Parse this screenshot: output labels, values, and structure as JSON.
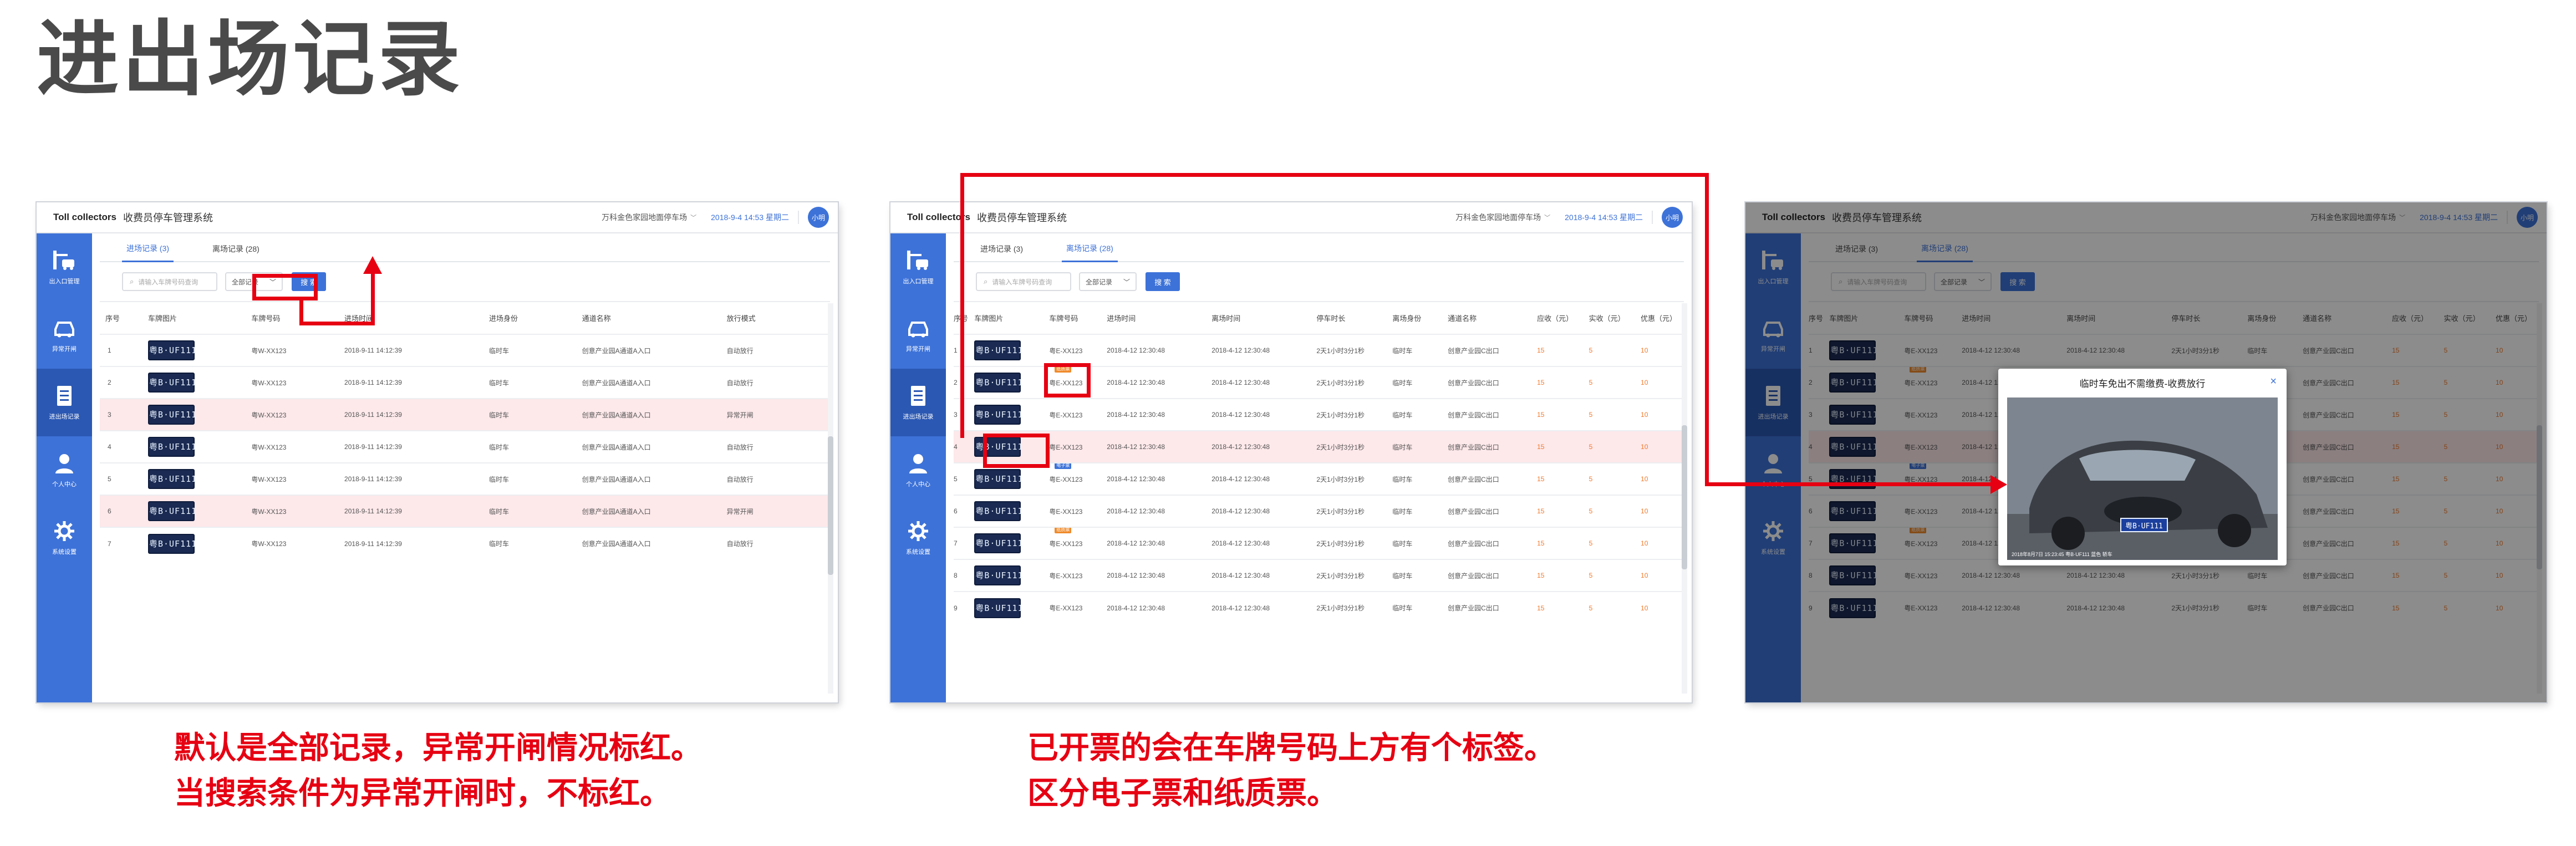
{
  "page": {
    "title": "进出场记录",
    "caption_left": [
      "默认是全部记录，异常开闸情况标红。",
      "当搜索条件为异常开闸时，不标红。"
    ],
    "caption_right": [
      "已开票的会在车牌号码上方有个标签。",
      "区分电子票和纸质票。"
    ]
  },
  "app": {
    "brand": "Toll collectors",
    "system": "收费员停车管理系统",
    "lot": "万科金色家园地面停车场",
    "datetime": "2018-9-4 14:53 星期二",
    "user": "小明",
    "sidebar": [
      {
        "label": "出入口管理",
        "icon": "gate-icon"
      },
      {
        "label": "异常开闸",
        "icon": "car-icon"
      },
      {
        "label": "进出场记录",
        "icon": "document-icon"
      },
      {
        "label": "个人中心",
        "icon": "user-icon"
      },
      {
        "label": "系统设置",
        "icon": "gear-icon"
      }
    ],
    "tabs": [
      "进场记录  (3)",
      "离场记录  (28)"
    ],
    "search_placeholder": "请输入车牌号码查询",
    "filter_value": "全部记录",
    "search_button": "搜 索"
  },
  "entry_table": {
    "headers": [
      "序号",
      "车牌图片",
      "车牌号码",
      "进场时间",
      "进场身份",
      "通道名称",
      "放行模式"
    ],
    "rows": [
      {
        "no": "1",
        "plate_img": "粤B·UF111",
        "plate": "粤W-XX123",
        "time": "2018-9-11 14:12:39",
        "identity": "临时车",
        "channel": "创意产业园A通道A入口",
        "mode": "自动放行",
        "abnormal": false
      },
      {
        "no": "2",
        "plate_img": "粤B·UF111",
        "plate": "粤W-XX123",
        "time": "2018-9-11 14:12:39",
        "identity": "临时车",
        "channel": "创意产业园A通道A入口",
        "mode": "自动放行",
        "abnormal": false
      },
      {
        "no": "3",
        "plate_img": "粤B·UF111",
        "plate": "粤W-XX123",
        "time": "2018-9-11 14:12:39",
        "identity": "临时车",
        "channel": "创意产业园A通道A入口",
        "mode": "异常开闸",
        "abnormal": true
      },
      {
        "no": "4",
        "plate_img": "粤B·UF111",
        "plate": "粤W-XX123",
        "time": "2018-9-11 14:12:39",
        "identity": "临时车",
        "channel": "创意产业园A通道A入口",
        "mode": "自动放行",
        "abnormal": false
      },
      {
        "no": "5",
        "plate_img": "粤B·UF111",
        "plate": "粤W-XX123",
        "time": "2018-9-11 14:12:39",
        "identity": "临时车",
        "channel": "创意产业园A通道A入口",
        "mode": "自动放行",
        "abnormal": false
      },
      {
        "no": "6",
        "plate_img": "粤B·UF111",
        "plate": "粤W-XX123",
        "time": "2018-9-11 14:12:39",
        "identity": "临时车",
        "channel": "创意产业园A通道A入口",
        "mode": "异常开闸",
        "abnormal": true
      },
      {
        "no": "7",
        "plate_img": "粤B·UF111",
        "plate": "粤W-XX123",
        "time": "2018-9-11 14:12:39",
        "identity": "临时车",
        "channel": "创意产业园A通道A入口",
        "mode": "自动放行",
        "abnormal": false
      }
    ]
  },
  "exit_table": {
    "headers": [
      "序号",
      "车牌图片",
      "车牌号码",
      "进场时间",
      "离场时间",
      "停车时长",
      "离场身份",
      "通道名称",
      "应收（元）",
      "实收（元）",
      "优惠（元）"
    ],
    "rows": [
      {
        "no": "1",
        "plate_img": "粤B·UF111",
        "plate": "粤E-XX123",
        "tag": "",
        "in": "2018-4-12 12:30:48",
        "out": "2018-4-12 12:30:48",
        "dur": "2天1小时3分1秒",
        "identity": "临时车",
        "channel": "创意产业园C出口",
        "due": "15",
        "paid": "5",
        "disc": "10",
        "abnormal": false
      },
      {
        "no": "2",
        "plate_img": "粤B·UF111",
        "plate": "粤E-XX123",
        "tag": "纸质票",
        "in": "2018-4-12 12:30:48",
        "out": "2018-4-12 12:30:48",
        "dur": "2天1小时3分1秒",
        "identity": "临时车",
        "channel": "创意产业园C出口",
        "due": "15",
        "paid": "5",
        "disc": "10",
        "abnormal": false
      },
      {
        "no": "3",
        "plate_img": "粤B·UF111",
        "plate": "粤E-XX123",
        "tag": "",
        "in": "2018-4-12 12:30:48",
        "out": "2018-4-12 12:30:48",
        "dur": "2天1小时3分1秒",
        "identity": "临时车",
        "channel": "创意产业园C出口",
        "due": "15",
        "paid": "5",
        "disc": "10",
        "abnormal": false
      },
      {
        "no": "4",
        "plate_img": "粤B·UF111",
        "plate": "粤E-XX123",
        "tag": "",
        "in": "2018-4-12 12:30:48",
        "out": "2018-4-12 12:30:48",
        "dur": "2天1小时3分1秒",
        "identity": "临时车",
        "channel": "创意产业园C出口",
        "due": "15",
        "paid": "5",
        "disc": "10",
        "abnormal": true
      },
      {
        "no": "5",
        "plate_img": "粤B·UF111",
        "plate": "粤E-XX123",
        "tag": "电子票",
        "in": "2018-4-12 12:30:48",
        "out": "2018-4-12 12:30:48",
        "dur": "2天1小时3分1秒",
        "identity": "临时车",
        "channel": "创意产业园C出口",
        "due": "15",
        "paid": "5",
        "disc": "10",
        "abnormal": false
      },
      {
        "no": "6",
        "plate_img": "粤B·UF111",
        "plate": "粤E-XX123",
        "tag": "",
        "in": "2018-4-12 12:30:48",
        "out": "2018-4-12 12:30:48",
        "dur": "2天1小时3分1秒",
        "identity": "临时车",
        "channel": "创意产业园C出口",
        "due": "15",
        "paid": "5",
        "disc": "10",
        "abnormal": false
      },
      {
        "no": "7",
        "plate_img": "粤B·UF111",
        "plate": "粤E-XX123",
        "tag": "纸质票",
        "in": "2018-4-12 12:30:48",
        "out": "2018-4-12 12:30:48",
        "dur": "2天1小时3分1秒",
        "identity": "临时车",
        "channel": "创意产业园C出口",
        "due": "15",
        "paid": "5",
        "disc": "10",
        "abnormal": false
      },
      {
        "no": "8",
        "plate_img": "粤B·UF111",
        "plate": "粤E-XX123",
        "tag": "",
        "in": "2018-4-12 12:30:48",
        "out": "2018-4-12 12:30:48",
        "dur": "2天1小时3分1秒",
        "identity": "临时车",
        "channel": "创意产业园C出口",
        "due": "15",
        "paid": "5",
        "disc": "10",
        "abnormal": false
      },
      {
        "no": "9",
        "plate_img": "粤B·UF111",
        "plate": "粤E-XX123",
        "tag": "",
        "in": "2018-4-12 12:30:48",
        "out": "2018-4-12 12:30:48",
        "dur": "2天1小时3分1秒",
        "identity": "临时车",
        "channel": "创意产业园C出口",
        "due": "15",
        "paid": "5",
        "disc": "10",
        "abnormal": false
      }
    ]
  },
  "modal": {
    "title": "临时车免出不需缴费-收费放行",
    "close": "×",
    "photo_caption": "2018年8月7日 15:23:45  粤B·UF111  蓝色 轿车",
    "photo_plate": "粤B·UF111"
  },
  "colors": {
    "primary": "#3d72d8",
    "abnormal_row": "#fde8ea",
    "annotation": "#e60012",
    "amount": "#f27a2c"
  }
}
